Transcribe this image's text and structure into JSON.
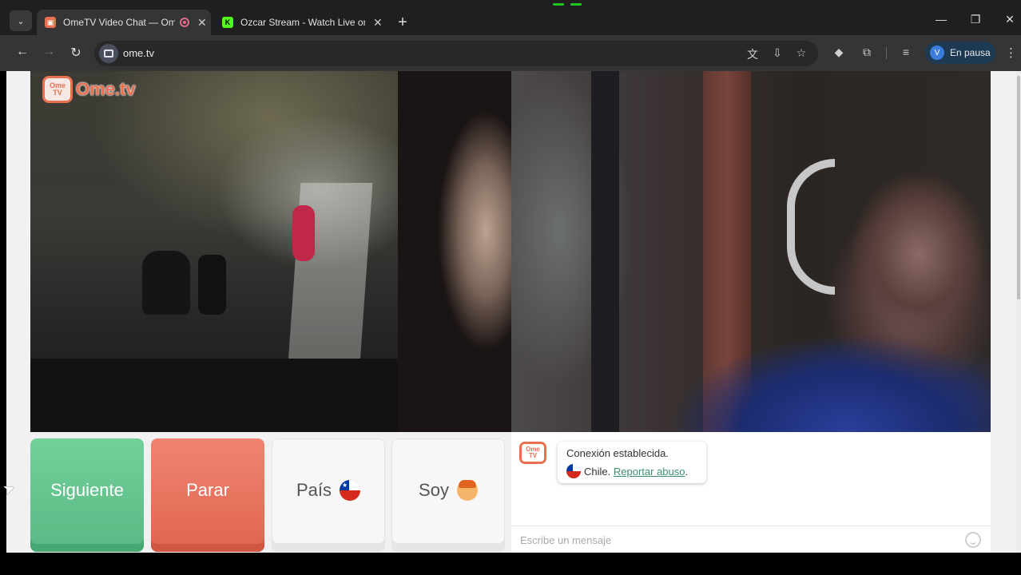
{
  "browser": {
    "tabs": [
      {
        "title": "OmeTV Video Chat — Ome",
        "active": true,
        "favicon": "ometv-favicon",
        "recording": true
      },
      {
        "title": "Ozcar Stream - Watch Live on K",
        "active": false,
        "favicon": "kick-favicon"
      }
    ],
    "url": "ome.tv",
    "profile_initial": "V",
    "profile_status": "En pausa"
  },
  "page": {
    "logo": {
      "badge_top": "Ome",
      "badge_bottom": "TV",
      "wordmark": "Ome.tv"
    },
    "buttons": {
      "next_label": "Siguiente",
      "stop_label": "Parar",
      "country_label": "País",
      "gender_label": "Soy"
    },
    "chat": {
      "status_message": "Conexión establecida.",
      "country_name": "Chile.",
      "report_link": "Reportar abuso",
      "report_suffix": ".",
      "input_placeholder": "Escribe un mensaje"
    },
    "colors": {
      "next": "#5ab884",
      "stop": "#e06550",
      "brand": "#e8704f",
      "link": "#3d8f6c"
    }
  }
}
